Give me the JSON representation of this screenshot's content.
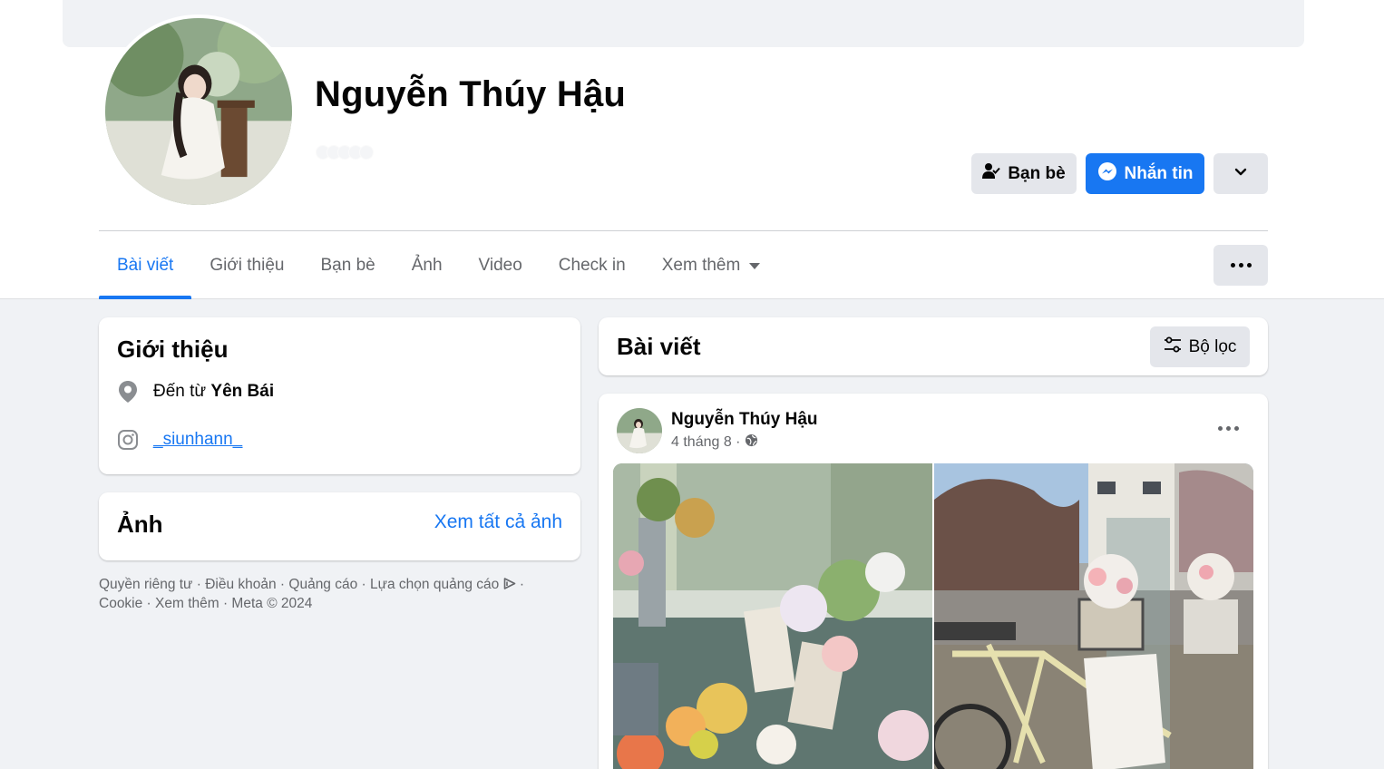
{
  "profile": {
    "name": "Nguyễn Thúy Hậu"
  },
  "actions": {
    "friends_label": "Bạn bè",
    "message_label": "Nhắn tin"
  },
  "tabs": [
    {
      "label": "Bài viết",
      "active": true
    },
    {
      "label": "Giới thiệu"
    },
    {
      "label": "Bạn bè"
    },
    {
      "label": "Ảnh"
    },
    {
      "label": "Video"
    },
    {
      "label": "Check in"
    },
    {
      "label": "Xem thêm"
    }
  ],
  "intro": {
    "title": "Giới thiệu",
    "from_prefix": "Đến từ",
    "from_place": "Yên Bái",
    "instagram": "_siunhann_"
  },
  "photos": {
    "title": "Ảnh",
    "see_all": "Xem tất cả ảnh"
  },
  "footer": {
    "line1": "Quyền riêng tư · Điều khoản · Quảng cáo · Lựa chọn quảng cáo",
    "line1_end": " ·",
    "line2": "Cookie · Xem thêm · Meta © 2024"
  },
  "posts": {
    "title": "Bài viết",
    "filter_label": "Bộ lọc",
    "first_post": {
      "author": "Nguyễn Thúy Hậu",
      "date": "4 tháng 8 ·"
    }
  },
  "colors": {
    "accent": "#1877f2",
    "background": "#f0f2f5",
    "button_gray": "#e4e6eb",
    "secondary_text": "#65676b"
  },
  "icons": [
    "friends-icon",
    "messenger-icon",
    "chevron-down-icon",
    "more-icon",
    "location-pin-icon",
    "instagram-icon",
    "filter-icon",
    "globe-icon",
    "adchoices-icon"
  ]
}
